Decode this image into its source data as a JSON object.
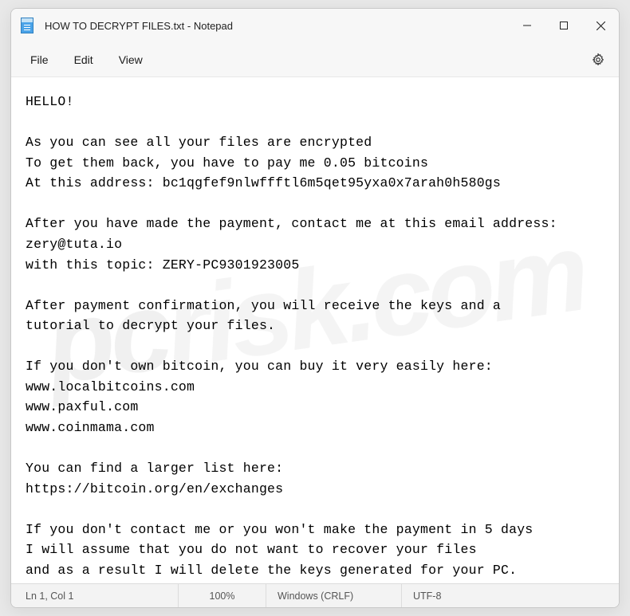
{
  "window": {
    "title": "HOW TO DECRYPT FILES.txt - Notepad"
  },
  "menu": {
    "file": "File",
    "edit": "Edit",
    "view": "View"
  },
  "document": {
    "text": "HELLO!\n\nAs you can see all your files are encrypted\nTo get them back, you have to pay me 0.05 bitcoins\nAt this address: bc1qgfef9nlwffftl6m5qet95yxa0x7arah0h580gs\n\nAfter you have made the payment, contact me at this email address:\nzery@tuta.io\nwith this topic: ZERY-PC9301923005\n\nAfter payment confirmation, you will receive the keys and a\ntutorial to decrypt your files.\n\nIf you don't own bitcoin, you can buy it very easily here:\nwww.localbitcoins.com\nwww.paxful.com\nwww.coinmama.com\n\nYou can find a larger list here:\nhttps://bitcoin.org/en/exchanges\n\nIf you don't contact me or you won't make the payment in 5 days\nI will assume that you do not want to recover your files\nand as a result I will delete the keys generated for your PC."
  },
  "statusbar": {
    "position": "Ln 1, Col 1",
    "zoom": "100%",
    "line_ending": "Windows (CRLF)",
    "encoding": "UTF-8"
  }
}
